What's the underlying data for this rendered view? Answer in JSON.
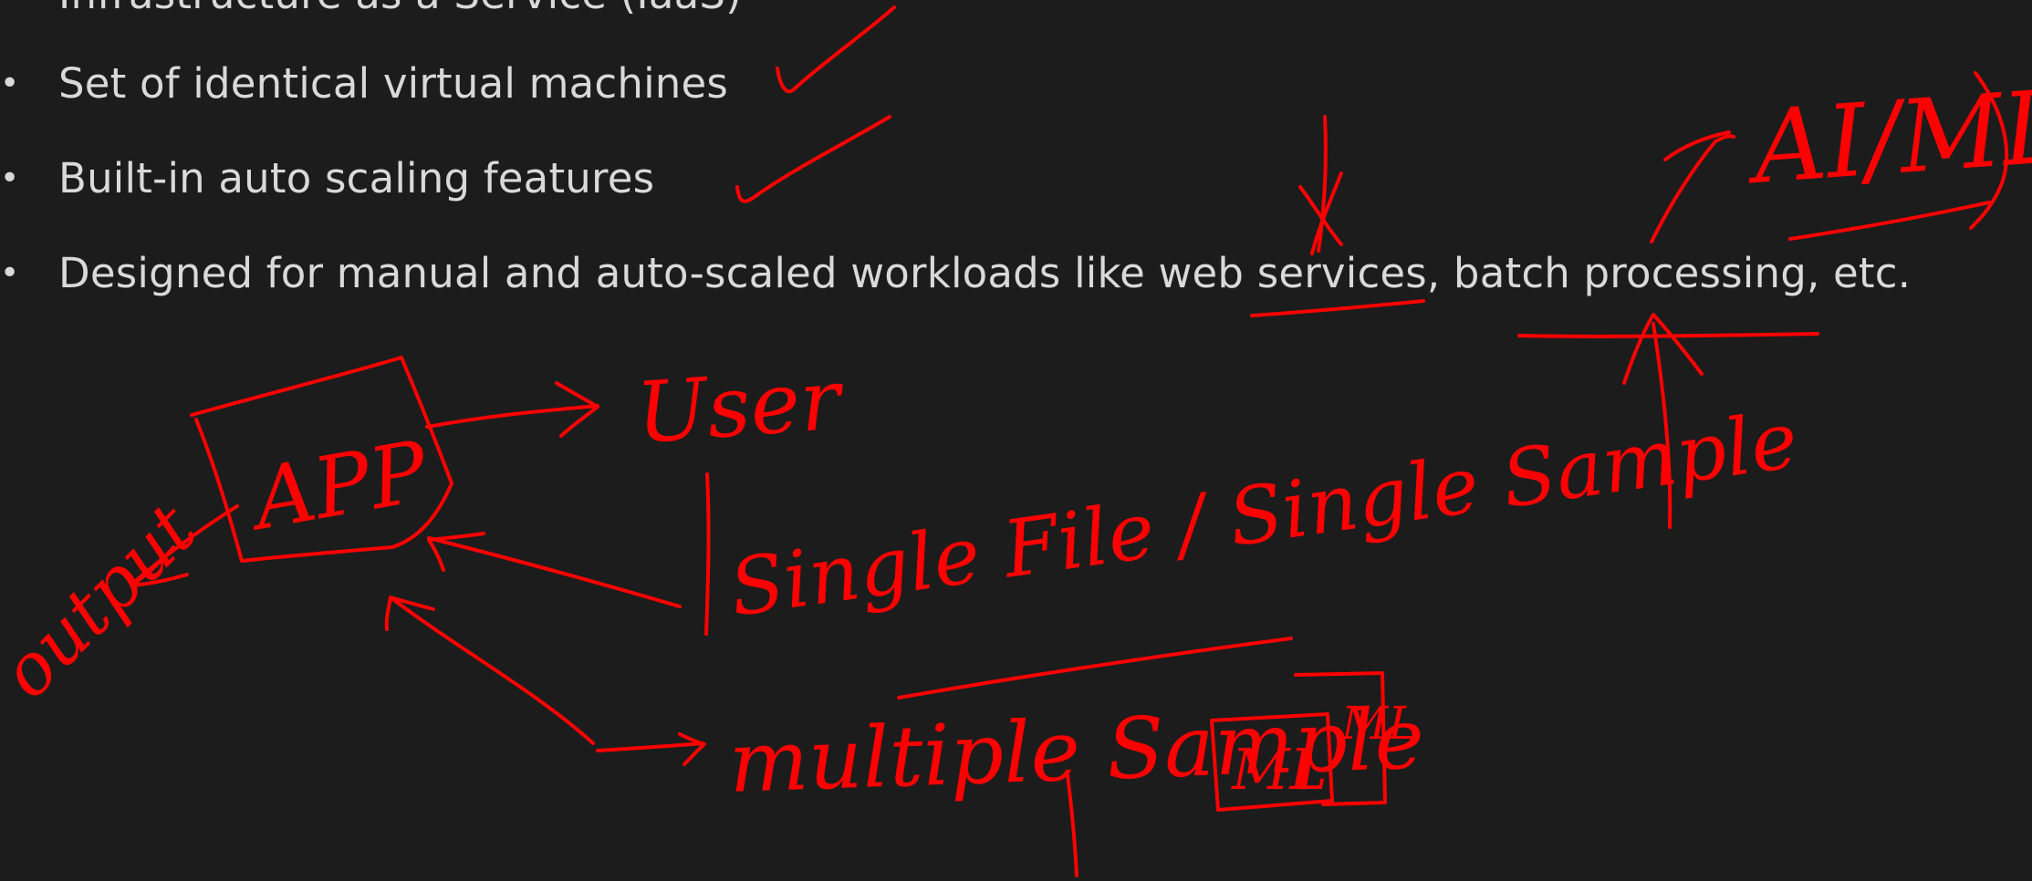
{
  "slide": {
    "bullets": [
      {
        "marker": "•",
        "text": "Infrastructure as a Service (IaaS)"
      },
      {
        "marker": "•",
        "text": "Set of identical virtual machines"
      },
      {
        "marker": "•",
        "text": "Built-in auto scaling features"
      },
      {
        "marker": "•",
        "text": "Designed for manual and auto-scaled workloads like web services, batch processing, etc."
      }
    ]
  },
  "annotations": {
    "color": "#ff0000",
    "handwritten": {
      "app": "APP",
      "user": "User",
      "output": "output",
      "single_file": "Single File / Single Sample",
      "multiple_sample": "multiple Sample",
      "ml_box_1": "ML",
      "ml_box_2": "ML",
      "ai_ml": "AI/ML"
    }
  }
}
